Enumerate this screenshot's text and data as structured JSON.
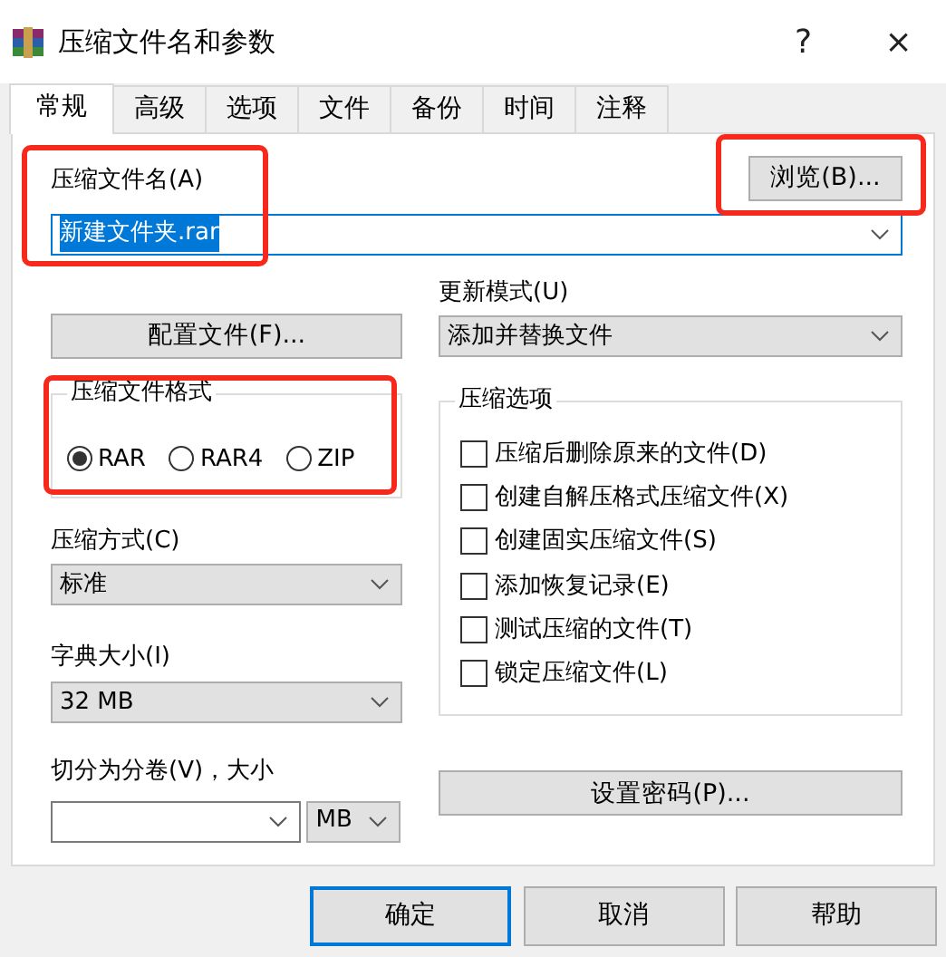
{
  "window": {
    "title": "压缩文件名和参数",
    "help": "?",
    "close": "×"
  },
  "tabs": [
    {
      "label": "常规",
      "selected": true
    },
    {
      "label": "高级",
      "selected": false
    },
    {
      "label": "选项",
      "selected": false
    },
    {
      "label": "文件",
      "selected": false
    },
    {
      "label": "备份",
      "selected": false
    },
    {
      "label": "时间",
      "selected": false
    },
    {
      "label": "注释",
      "selected": false
    }
  ],
  "archive_name": {
    "label": "压缩文件名(A)",
    "value": "新建文件夹.rar",
    "text_selected": true,
    "highlighted": true
  },
  "browse_button": {
    "label": "浏览(B)...",
    "highlighted": true
  },
  "profiles_button": {
    "label": "配置文件(F)..."
  },
  "update_mode": {
    "label": "更新模式(U)",
    "value": "添加并替换文件"
  },
  "archive_format": {
    "title": "压缩文件格式",
    "highlighted": true,
    "options": [
      {
        "label": "RAR",
        "selected": true
      },
      {
        "label": "RAR4",
        "selected": false
      },
      {
        "label": "ZIP",
        "selected": false
      }
    ]
  },
  "archiving_options": {
    "title": "压缩选项",
    "options": [
      {
        "label": "压缩后删除原来的文件(D)",
        "checked": false
      },
      {
        "label": "创建自解压格式压缩文件(X)",
        "checked": false
      },
      {
        "label": "创建固实压缩文件(S)",
        "checked": false
      },
      {
        "label": "添加恢复记录(E)",
        "checked": false
      },
      {
        "label": "测试压缩的文件(T)",
        "checked": false
      },
      {
        "label": "锁定压缩文件(L)",
        "checked": false
      }
    ]
  },
  "compression_method": {
    "label": "压缩方式(C)",
    "value": "标准"
  },
  "dictionary_size": {
    "label": "字典大小(I)",
    "value": "32 MB"
  },
  "split": {
    "label": "切分为分卷(V)，大小",
    "unit": "MB"
  },
  "password_button": {
    "label": "设置密码(P)..."
  },
  "buttons": [
    {
      "label": "确定",
      "default": true
    },
    {
      "label": "取消",
      "default": false
    },
    {
      "label": "帮助",
      "default": false
    }
  ]
}
